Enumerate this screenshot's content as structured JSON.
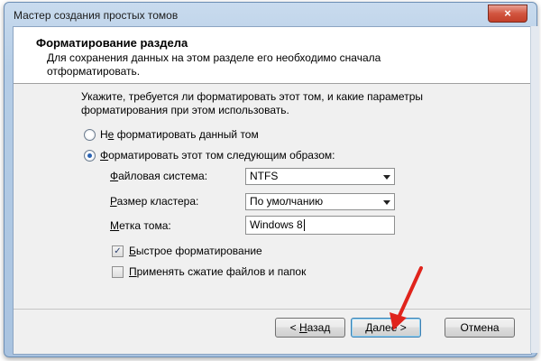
{
  "window": {
    "title": "Мастер создания простых томов",
    "close_label": "×"
  },
  "header": {
    "title": "Форматирование раздела",
    "subtitle": "Для сохранения данных на этом разделе его необходимо сначала отформатировать."
  },
  "body": {
    "instruction": "Укажите, требуется ли форматировать этот том, и какие параметры форматирования при этом использовать."
  },
  "options": {
    "no_format_prefix": "Н",
    "no_format_mnemonic": "е",
    "no_format_rest": " форматировать данный том",
    "format_mnemonic": "Ф",
    "format_rest": "орматировать этот том следующим образом:"
  },
  "fields": {
    "fs_mnemonic": "Ф",
    "fs_rest": "айловая система:",
    "fs_value": "NTFS",
    "cluster_mnemonic": "Р",
    "cluster_rest": "азмер кластера:",
    "cluster_value": "По умолчанию",
    "label_mnemonic": "М",
    "label_rest": "етка тома:",
    "label_value": "Windows 8"
  },
  "checkboxes": {
    "quick_mnemonic": "Б",
    "quick_rest": "ыстрое форматирование",
    "quick_checked": true,
    "compress_mnemonic": "П",
    "compress_rest": "рименять сжатие файлов и папок",
    "compress_checked": false
  },
  "buttons": {
    "back_prefix": "< ",
    "back_mnemonic": "Н",
    "back_rest": "азад",
    "next_mnemonic": "Д",
    "next_rest": "алее >",
    "cancel": "Отмена"
  },
  "colors": {
    "accent_arrow": "#e0241c",
    "radio_dot": "#2a63b3"
  }
}
